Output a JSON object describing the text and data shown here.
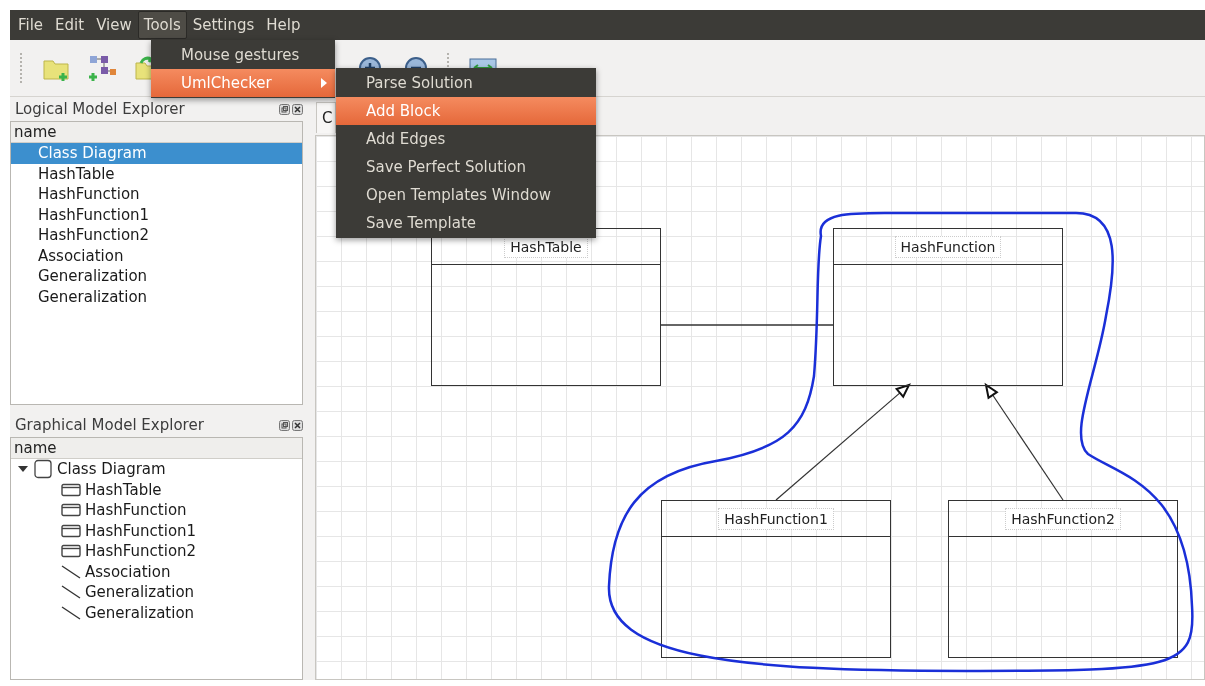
{
  "menubar": [
    {
      "label": "File",
      "selected": false
    },
    {
      "label": "Edit",
      "selected": false
    },
    {
      "label": "View",
      "selected": false
    },
    {
      "label": "Tools",
      "selected": true
    },
    {
      "label": "Settings",
      "selected": false
    },
    {
      "label": "Help",
      "selected": false
    }
  ],
  "tools_menu": {
    "items": [
      {
        "label": "Mouse gestures",
        "selected": false,
        "has_submenu": false
      },
      {
        "label": "UmlChecker",
        "selected": true,
        "has_submenu": true
      }
    ]
  },
  "submenu": {
    "items": [
      {
        "label": "Parse Solution",
        "selected": false
      },
      {
        "label": "Add Block",
        "selected": true
      },
      {
        "label": "Add Edges",
        "selected": false
      },
      {
        "label": "Save Perfect Solution",
        "selected": false
      },
      {
        "label": "Open Templates Window",
        "selected": false
      },
      {
        "label": "Save Template",
        "selected": false
      }
    ]
  },
  "logical_explorer": {
    "title": "Logical Model Explorer",
    "column": "name",
    "items": [
      {
        "label": "Class Diagram",
        "selected": true
      },
      {
        "label": "HashTable",
        "selected": false
      },
      {
        "label": "HashFunction",
        "selected": false
      },
      {
        "label": "HashFunction1",
        "selected": false
      },
      {
        "label": "HashFunction2",
        "selected": false
      },
      {
        "label": "Association",
        "selected": false
      },
      {
        "label": "Generalization",
        "selected": false
      },
      {
        "label": "Generalization",
        "selected": false
      }
    ]
  },
  "graphical_explorer": {
    "title": "Graphical Model Explorer",
    "column": "name",
    "tree": [
      {
        "label": "Class Diagram",
        "kind": "diagram",
        "expanded": true,
        "children": [
          {
            "label": "HashTable",
            "kind": "class"
          },
          {
            "label": "HashFunction",
            "kind": "class"
          },
          {
            "label": "HashFunction1",
            "kind": "class"
          },
          {
            "label": "HashFunction2",
            "kind": "class"
          },
          {
            "label": "Association",
            "kind": "edge"
          },
          {
            "label": "Generalization",
            "kind": "edge"
          },
          {
            "label": "Generalization",
            "kind": "edge"
          }
        ]
      }
    ]
  },
  "tabs": [
    {
      "label": "C",
      "selected": true
    }
  ],
  "diagram": {
    "classes": [
      {
        "name": "HashTable"
      },
      {
        "name": "HashFunction"
      },
      {
        "name": "HashFunction1"
      },
      {
        "name": "HashFunction2"
      }
    ],
    "edges": [
      {
        "kind": "association"
      },
      {
        "kind": "generalization"
      },
      {
        "kind": "generalization"
      }
    ]
  }
}
